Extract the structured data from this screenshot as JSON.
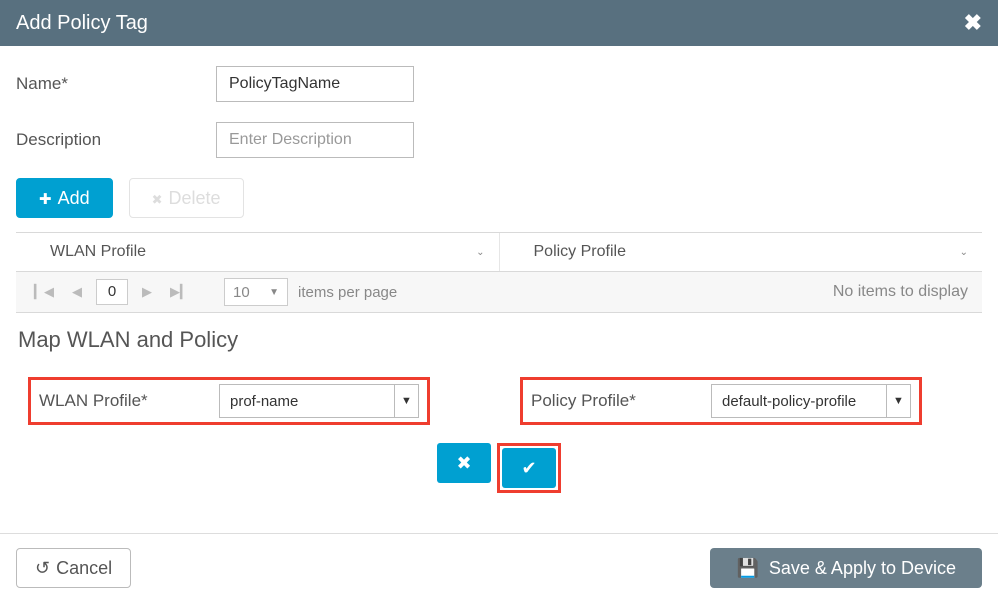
{
  "header": {
    "title": "Add Policy Tag"
  },
  "form": {
    "name_label": "Name*",
    "name_value": "PolicyTagName",
    "desc_label": "Description",
    "desc_placeholder": "Enter Description"
  },
  "buttons": {
    "add": "Add",
    "delete": "Delete",
    "cancel": "Cancel",
    "save": "Save & Apply to Device"
  },
  "grid": {
    "cols": [
      "WLAN Profile",
      "Policy Profile"
    ],
    "page": "0",
    "page_size": "10",
    "per_page_label": "items per page",
    "empty": "No items to display"
  },
  "map": {
    "title": "Map WLAN and Policy",
    "wlan_label": "WLAN Profile*",
    "wlan_value": "prof-name",
    "policy_label": "Policy Profile*",
    "policy_value": "default-policy-profile"
  }
}
